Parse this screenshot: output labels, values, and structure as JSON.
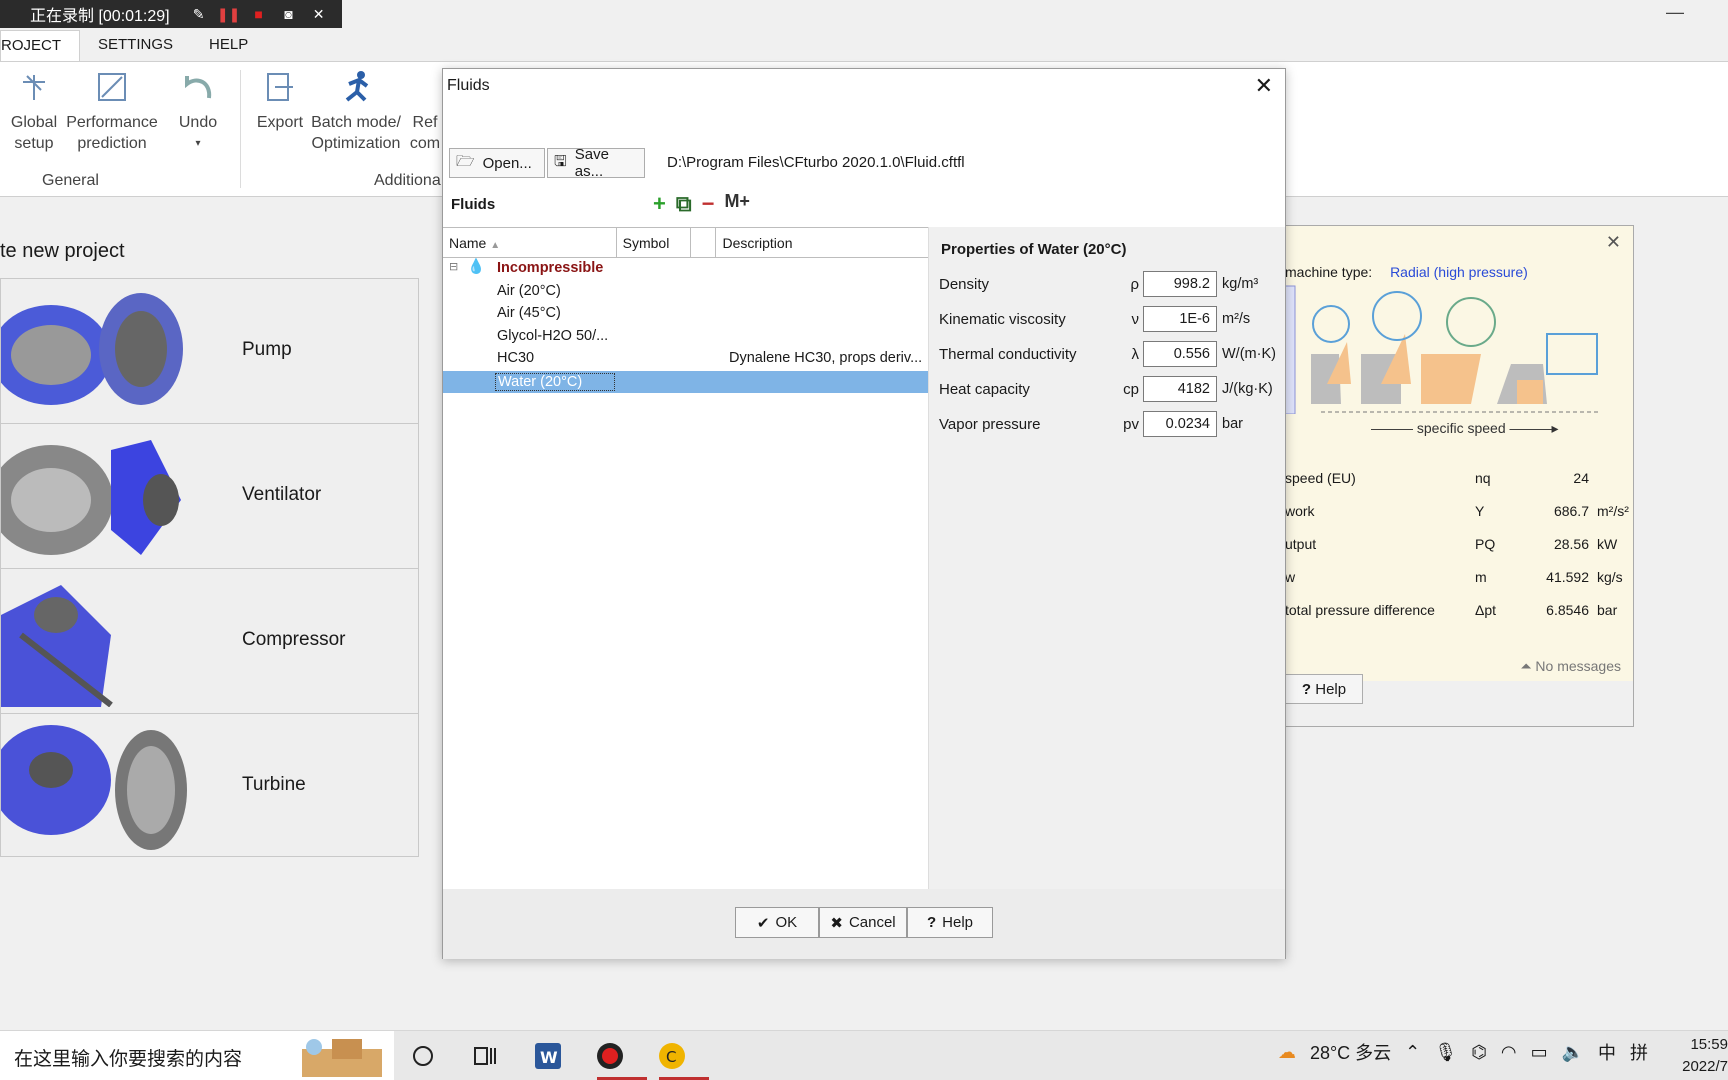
{
  "recorder": {
    "status": "正在录制 [00:01:29]"
  },
  "menu": {
    "items": [
      "ROJECT",
      "SETTINGS",
      "HELP"
    ]
  },
  "ribbon": {
    "global_setup": "Global\nsetup",
    "performance": "Performance\nprediction",
    "undo": "Undo",
    "export": "Export",
    "batch": "Batch mode/\nOptimization",
    "ref": "Ref\ncom",
    "group_general": "General",
    "group_additional": "Additiona"
  },
  "start": {
    "title": "te new project",
    "tiles": [
      "Pump",
      "Ventilator",
      "Compressor",
      "Turbine"
    ]
  },
  "bg_dialog": {
    "machine_type_label": "machine type:",
    "machine_type_value": "Radial (high pressure)",
    "specific_speed": "specific speed",
    "rows": [
      {
        "name": "speed (EU)",
        "symbol": "nq",
        "value": "24",
        "unit": ""
      },
      {
        "name": "work",
        "symbol": "Y",
        "value": "686.7",
        "unit": "m²/s²"
      },
      {
        "name": "utput",
        "symbol": "PQ",
        "value": "28.56",
        "unit": "kW"
      },
      {
        "name": "w",
        "symbol": "m",
        "value": "41.592",
        "unit": "kg/s"
      },
      {
        "name": "total pressure difference",
        "symbol": "Δpt",
        "value": "6.8546",
        "unit": "bar"
      }
    ],
    "no_messages": "No messages",
    "help": "Help"
  },
  "dialog": {
    "title": "Fluids",
    "open": "Open...",
    "save_as": "Save as...",
    "path": "D:\\Program Files\\CFturbo 2020.1.0\\Fluid.cftfl",
    "fluids_label": "Fluids",
    "columns": [
      "Name",
      "Symbol",
      "Description"
    ],
    "group": "Incompressible",
    "items": [
      {
        "name": "Air (20°C)",
        "desc": ""
      },
      {
        "name": "Air (45°C)",
        "desc": ""
      },
      {
        "name": "Glycol-H2O 50/...",
        "desc": ""
      },
      {
        "name": "HC30",
        "desc": "Dynalene HC30, props deriv..."
      },
      {
        "name": "Water (20°C)",
        "desc": ""
      }
    ],
    "properties_title": "Properties of Water (20°C)",
    "properties": [
      {
        "name": "Density",
        "symbol": "ρ",
        "value": "998.2",
        "unit": "kg/m³"
      },
      {
        "name": "Kinematic viscosity",
        "symbol": "ν",
        "value": "1E-6",
        "unit": "m²/s"
      },
      {
        "name": "Thermal conductivity",
        "symbol": "λ",
        "value": "0.556",
        "unit": "W/(m·K)"
      },
      {
        "name": "Heat capacity",
        "symbol": "cp",
        "value": "4182",
        "unit": "J/(kg·K)"
      },
      {
        "name": "Vapor pressure",
        "symbol": "pv",
        "value": "0.0234",
        "unit": "bar"
      }
    ],
    "ok": "OK",
    "cancel": "Cancel",
    "help": "Help"
  },
  "taskbar": {
    "search_placeholder": "在这里输入你要搜索的内容",
    "weather": "28°C 多云",
    "ime1": "中",
    "ime2": "拼",
    "time": "15:59",
    "date": "2022/7"
  }
}
